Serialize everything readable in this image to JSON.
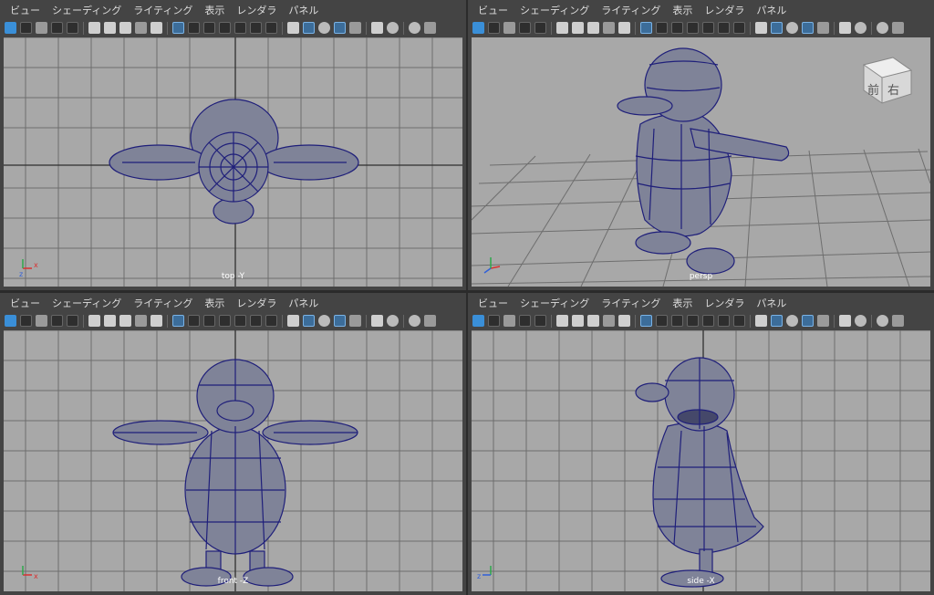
{
  "menu": [
    "ビュー",
    "シェーディング",
    "ライティング",
    "表示",
    "レンダラ",
    "パネル"
  ],
  "viewports": {
    "top": {
      "label": "top -Y"
    },
    "persp": {
      "label": "persp"
    },
    "front": {
      "label": "front -Z"
    },
    "side": {
      "label": "side -X"
    }
  },
  "viewcube": {
    "front": "前",
    "right": "右"
  },
  "colors": {
    "viewport_bg": "#a8a8a8",
    "grid": "#6e6e6e",
    "axis": "#2f2f2f",
    "mesh_fill": "#7f8398",
    "wire": "#1f1f7a"
  }
}
